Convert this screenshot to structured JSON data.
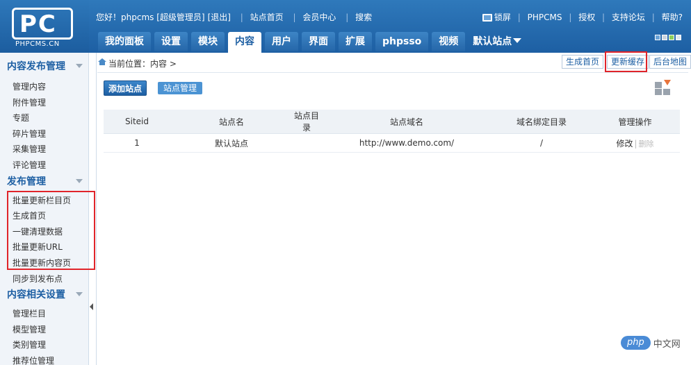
{
  "header": {
    "logo_text": "PC",
    "logo_caption": "PHPCMS.CN",
    "greeting": "您好！phpcms [超级管理员]",
    "logout": "[退出]",
    "site_home": "站点首页",
    "member_center": "会员中心",
    "search": "搜索",
    "lock_screen": "锁屏",
    "product": "PHPCMS",
    "license": "授权",
    "support_forum": "支持论坛",
    "help": "帮助?"
  },
  "nav": {
    "tabs": [
      "我的面板",
      "设置",
      "模块",
      "内容",
      "用户",
      "界面",
      "扩展",
      "phpsso",
      "视频"
    ],
    "active_index": 3,
    "site_selector": "默认站点"
  },
  "sidebar": {
    "sections": [
      {
        "title": "内容发布管理",
        "items": [
          "管理内容",
          "附件管理",
          "专题",
          "碎片管理",
          "采集管理",
          "评论管理"
        ]
      },
      {
        "title": "发布管理",
        "items": [
          "批量更新栏目页",
          "生成首页",
          "一键清理数据",
          "批量更新URL",
          "批量更新内容页",
          "同步到发布点"
        ]
      },
      {
        "title": "内容相关设置",
        "items": [
          "管理栏目",
          "模型管理",
          "类别管理",
          "推荐位管理"
        ]
      }
    ]
  },
  "breadcrumb": {
    "label": "当前位置：内容 >"
  },
  "quick_actions": {
    "generate_home": "生成首页",
    "update_cache": "更新缓存",
    "backend_map": "后台地图"
  },
  "toolbar": {
    "add_site": "添加站点",
    "site_manage": "站点管理"
  },
  "table": {
    "headers": [
      "Siteid",
      "站点名",
      "站点目录",
      "站点域名",
      "域名绑定目录",
      "管理操作"
    ],
    "rows": [
      {
        "siteid": "1",
        "name": "默认站点",
        "dir": "",
        "domain": "http://www.demo.com/",
        "bind_dir": "/",
        "edit": "修改",
        "sep": "|",
        "delete": "删除"
      }
    ]
  },
  "watermark": {
    "logo": "php",
    "text": "中文网"
  },
  "colors": {
    "header_blue": "#1d5fa3",
    "highlight_red": "#e0242a",
    "sidebar_bg": "#f0f4f9"
  }
}
